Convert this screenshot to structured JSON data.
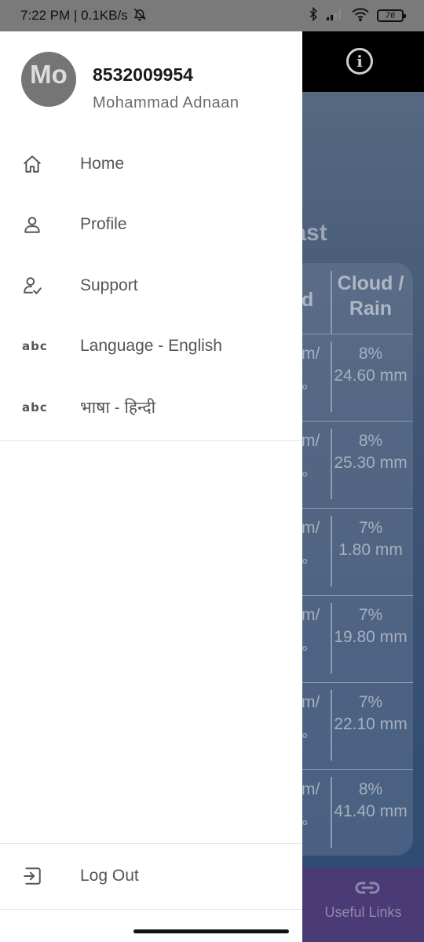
{
  "status_bar": {
    "time_speed": "7:22 PM | 0.1KB/s",
    "battery": "76"
  },
  "background": {
    "info_icon": "info-icon",
    "heading_fragment": "ecast",
    "column_header_partial": "d",
    "column_header": "Cloud / Rain",
    "rows": [
      {
        "left": "m/",
        "left2": "°",
        "pct": "8%",
        "amount": "24.60 mm"
      },
      {
        "left": "m/",
        "left2": "°",
        "pct": "8%",
        "amount": "25.30 mm"
      },
      {
        "left": "m/",
        "left2": "°",
        "pct": "7%",
        "amount": "1.80 mm"
      },
      {
        "left": "m/",
        "left2": "°",
        "pct": "7%",
        "amount": "19.80 mm"
      },
      {
        "left": "m/",
        "left2": "°",
        "pct": "7%",
        "amount": "22.10 mm"
      },
      {
        "left": "m/",
        "left2": "°",
        "pct": "8%",
        "amount": "41.40 mm"
      }
    ],
    "bottom_nav_label": "Useful Links"
  },
  "drawer": {
    "avatar_initials": "Mo",
    "phone": "8532009954",
    "name": "Mohammad Adnaan",
    "menu": [
      {
        "label": "Home",
        "icon": "home-icon"
      },
      {
        "label": "Profile",
        "icon": "person-icon"
      },
      {
        "label": "Support",
        "icon": "person-check-icon"
      },
      {
        "label": "Language - English",
        "icon": "abc-icon"
      },
      {
        "label": "भाषा - हिन्दी",
        "icon": "abc-icon"
      }
    ],
    "logout_label": "Log Out"
  },
  "colors": {
    "drawer_bg": "#ffffff",
    "status_bar": "#7a7a7a",
    "bottom_nav": "#4a3a76"
  }
}
